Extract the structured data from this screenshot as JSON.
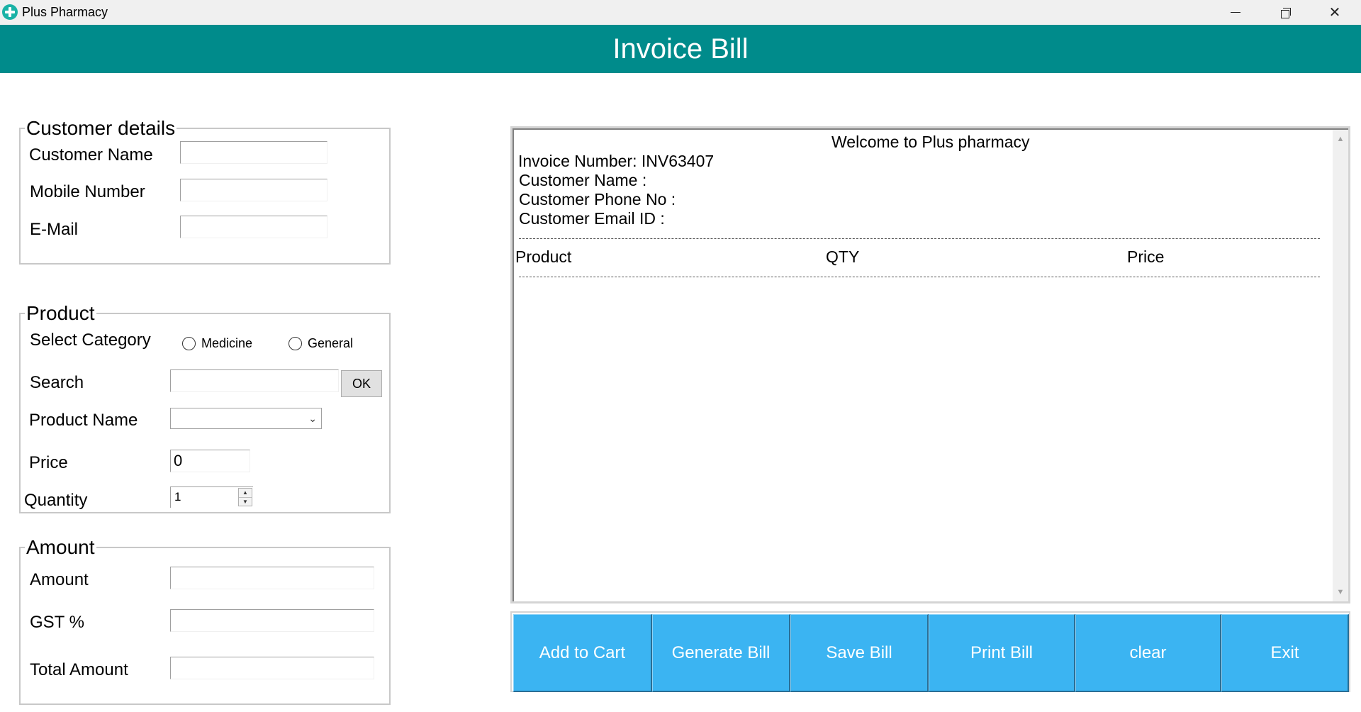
{
  "window": {
    "title": "Plus Pharmacy",
    "minimize_glyph": "minimize-icon",
    "maximize_glyph": "restore-icon",
    "close_glyph": "✕"
  },
  "header": {
    "title": "Invoice Bill",
    "color": "#008b8b"
  },
  "customer": {
    "legend": "Customer details",
    "name_label": "Customer Name",
    "name_value": "",
    "mobile_label": "Mobile Number",
    "mobile_value": "",
    "email_label": "E-Mail",
    "email_value": ""
  },
  "product": {
    "legend": "Product",
    "category_label": "Select Category",
    "category_options": [
      "Medicine",
      "General"
    ],
    "search_label": "Search",
    "search_value": "",
    "ok_label": "OK",
    "product_name_label": "Product Name",
    "product_name_value": "",
    "price_label": "Price",
    "price_value": "0",
    "quantity_label": "Quantity",
    "quantity_value": "1"
  },
  "amount": {
    "legend": "Amount",
    "amount_label": "Amount",
    "amount_value": "",
    "gst_label": "GST %",
    "gst_value": "",
    "total_label": "Total Amount",
    "total_value": ""
  },
  "bill": {
    "welcome": "Welcome to Plus pharmacy",
    "invoice_line": "Invoice Number: INV63407",
    "customer_name_line": "Customer Name :",
    "customer_phone_line": "Customer Phone No :",
    "customer_email_line": "Customer Email ID :",
    "columns": [
      "Product",
      "QTY",
      "Price"
    ]
  },
  "actions": {
    "color": "#3bb4f2",
    "buttons": [
      "Add to Cart",
      "Generate Bill",
      "Save Bill",
      "Print Bill",
      "clear",
      "Exit"
    ]
  }
}
